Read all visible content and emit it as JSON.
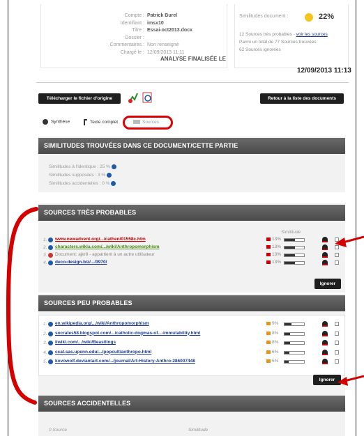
{
  "meta": {
    "compte_label": "Compte :",
    "compte": "Patrick Burel",
    "identifiant_label": "Identifiant :",
    "identifiant": "imsx10",
    "titre_label": "Titre :",
    "titre": "Essai-oct2013.docx",
    "dossier_label": "Dossier :",
    "dossier": "",
    "commentaires_label": "Commentaires :",
    "commentaires": "Non renseigné",
    "charge_label": "Chargé le :",
    "charge": "12/09/2013 11:11"
  },
  "similitudes": {
    "label": "Similitudes document :",
    "percent": "22%",
    "line1": "12 Sources très probables - ",
    "line1_link": "voir les sources",
    "line2": "Parmi un total de 77 Sources trouvées",
    "line3": "62 Sources ignorées"
  },
  "analyse": {
    "title": "ANALYSE FINALISÉE LE",
    "date": "12/09/2013 11:13"
  },
  "toolbar": {
    "download": "Télécharger le fichier d'origine",
    "back": "Retour à la liste des documents"
  },
  "tabs": {
    "synthese": "Synthèse",
    "texte": "Texte complet",
    "sources": "Sources"
  },
  "found": {
    "header": "SIMILITUDES TROUVÉES DANS CE DOCUMENT/CETTE PARTIE",
    "identique": "Similitudes à l'identique : 25 %",
    "supposees": "Similitudes supposées : 3 %",
    "accidentelles": "Similitudes accidentelles : 0 %"
  },
  "tres_probables": {
    "header": "SOURCES TRÈS PROBABLES",
    "col": "Similitude",
    "ignore": "Ignorer",
    "rows": [
      {
        "num": "1.",
        "text": "www.newadvent.org/.../cathen/01558c.htm",
        "pct": "13%",
        "fill": 0.55,
        "color": "#c00000"
      },
      {
        "num": "2.",
        "text": "characters.wikia.com/.../wiki/Anthropomorphism",
        "pct": "13%",
        "fill": 0.55,
        "color": "#4a8a1c"
      },
      {
        "num": "3.",
        "text": "Document: ajkr8 - appartient à un autre utilisateur",
        "pct": "13%",
        "fill": 0.55,
        "color": "#888888"
      },
      {
        "num": "4.",
        "text": "deco-design.biz/.../3970/",
        "pct": "13%",
        "fill": 0.55,
        "color": "#1e3a8a"
      }
    ]
  },
  "peu_probables": {
    "header": "SOURCES PEU PROBABLES",
    "ignore": "Ignorer",
    "rows": [
      {
        "num": "1.",
        "text": "en.wikipedia.org/.../wiki/Anthropomorphism",
        "pct": "9%",
        "fill": 0.35
      },
      {
        "num": "2.",
        "text": "socrates58.blogspot.com/.../catholic-dogmas-of...-immutability.html",
        "pct": "8%",
        "fill": 0.3
      },
      {
        "num": "3.",
        "text": "iiwiki.com/.../wiki/Beastlings",
        "pct": "8%",
        "fill": 0.3
      },
      {
        "num": "4.",
        "text": "ccat.sas.upenn.edu/.../popcult/anthropo.html",
        "pct": "6%",
        "fill": 0.25
      },
      {
        "num": "5.",
        "text": "kovowolf.deviantart.com/.../journal/Art-History-Anthro-286007448",
        "pct": "5%",
        "fill": 0.2
      }
    ]
  },
  "accidentelles": {
    "header": "SOURCES ACCIDENTELLES",
    "col1": "0 Source",
    "col2": "Similitude"
  }
}
